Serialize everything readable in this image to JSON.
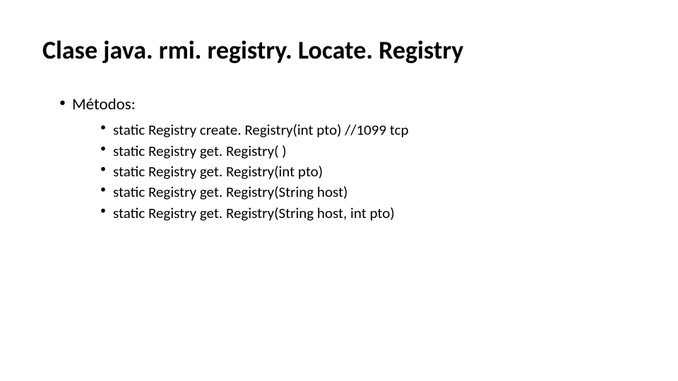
{
  "slide": {
    "title": "Clase java. rmi. registry. Locate. Registry",
    "outer_label": "Métodos:",
    "items": [
      "static Registry create. Registry(int pto)  //1099 tcp",
      "static Registry get. Registry( )",
      "static Registry get. Registry(int pto)",
      "static Registry get. Registry(String host)",
      "static Registry get. Registry(String host, int pto)"
    ]
  }
}
